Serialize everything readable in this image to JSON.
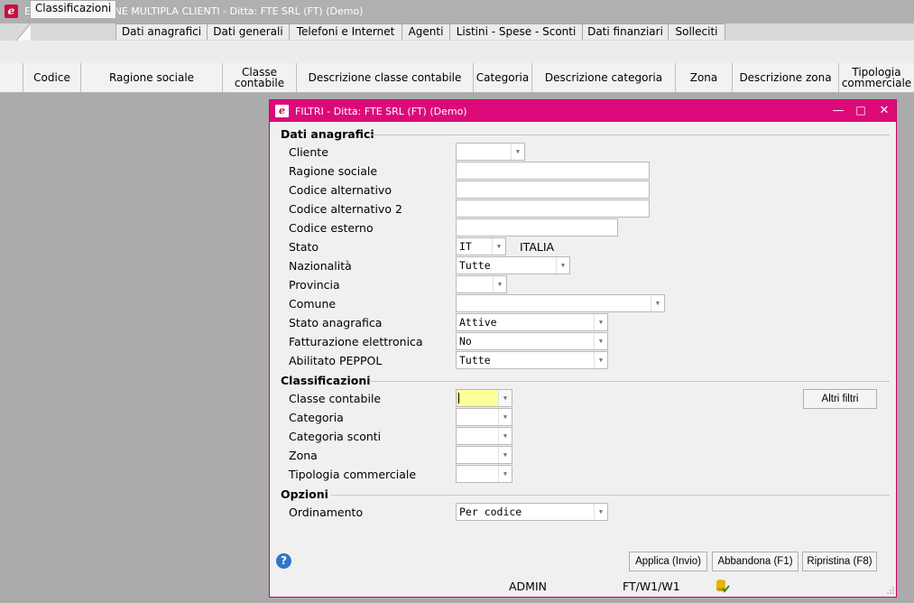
{
  "window": {
    "title": "EG801 - VARIAZIONE MULTIPLA CLIENTI  - Ditta: FTE SRL (FT)  (Demo)"
  },
  "tabs": [
    {
      "label": "Classificazioni"
    },
    {
      "label": "Dati anagrafici"
    },
    {
      "label": "Dati generali"
    },
    {
      "label": "Telefoni e Internet"
    },
    {
      "label": "Agenti"
    },
    {
      "label": "Listini - Spese - Sconti"
    },
    {
      "label": "Dati finanziari"
    },
    {
      "label": "Solleciti"
    }
  ],
  "grid": {
    "columns": [
      {
        "label": "Codice"
      },
      {
        "label": "Ragione sociale"
      },
      {
        "label": "Classe contabile"
      },
      {
        "label": "Descrizione classe contabile"
      },
      {
        "label": "Categoria"
      },
      {
        "label": "Descrizione categoria"
      },
      {
        "label": "Zona"
      },
      {
        "label": "Descrizione zona"
      },
      {
        "label": "Tipologia commerciale"
      }
    ]
  },
  "dialog": {
    "title": "FILTRI - Ditta: FTE SRL (FT)  (Demo)",
    "dati_anagrafici": {
      "heading": "Dati anagrafici",
      "cliente": {
        "label": "Cliente",
        "value": ""
      },
      "ragione_sociale": {
        "label": "Ragione sociale",
        "value": ""
      },
      "codice_alternativo": {
        "label": "Codice alternativo",
        "value": ""
      },
      "codice_alternativo_2": {
        "label": "Codice alternativo 2",
        "value": ""
      },
      "codice_esterno": {
        "label": "Codice esterno",
        "value": ""
      },
      "stato": {
        "label": "Stato",
        "value": "IT",
        "description": "ITALIA"
      },
      "nazionalita": {
        "label": "Nazionalità",
        "value": "Tutte"
      },
      "provincia": {
        "label": "Provincia",
        "value": ""
      },
      "comune": {
        "label": "Comune",
        "value": ""
      },
      "stato_anagrafica": {
        "label": "Stato anagrafica",
        "value": "Attive"
      },
      "fatturazione_elettronica": {
        "label": "Fatturazione elettronica",
        "value": "No"
      },
      "abilitato_peppol": {
        "label": "Abilitato PEPPOL",
        "value": "Tutte"
      }
    },
    "classificazioni": {
      "heading": "Classificazioni",
      "classe_contabile": {
        "label": "Classe contabile",
        "value": ""
      },
      "categoria": {
        "label": "Categoria",
        "value": ""
      },
      "categoria_sconti": {
        "label": "Categoria sconti",
        "value": ""
      },
      "zona": {
        "label": "Zona",
        "value": ""
      },
      "tipologia_commerciale": {
        "label": "Tipologia commerciale",
        "value": ""
      },
      "altri_filtri": "Altri filtri"
    },
    "opzioni": {
      "heading": "Opzioni",
      "ordinamento": {
        "label": "Ordinamento",
        "value": "Per codice"
      }
    },
    "buttons": {
      "applica": "Applica (Invio)",
      "abbandona": "Abbandona (F1)",
      "ripristina": "Ripristina (F8)"
    },
    "status": {
      "user": "ADMIN",
      "path": "FT/W1/W1"
    }
  },
  "colors": {
    "dialog_accent": "#dc0a78",
    "focus_field": "#ffff99"
  },
  "icons": [
    "app-logo-icon",
    "help-icon",
    "minimize-icon",
    "maximize-icon",
    "close-icon",
    "database-check-icon",
    "dropdown-arrow-icon"
  ]
}
